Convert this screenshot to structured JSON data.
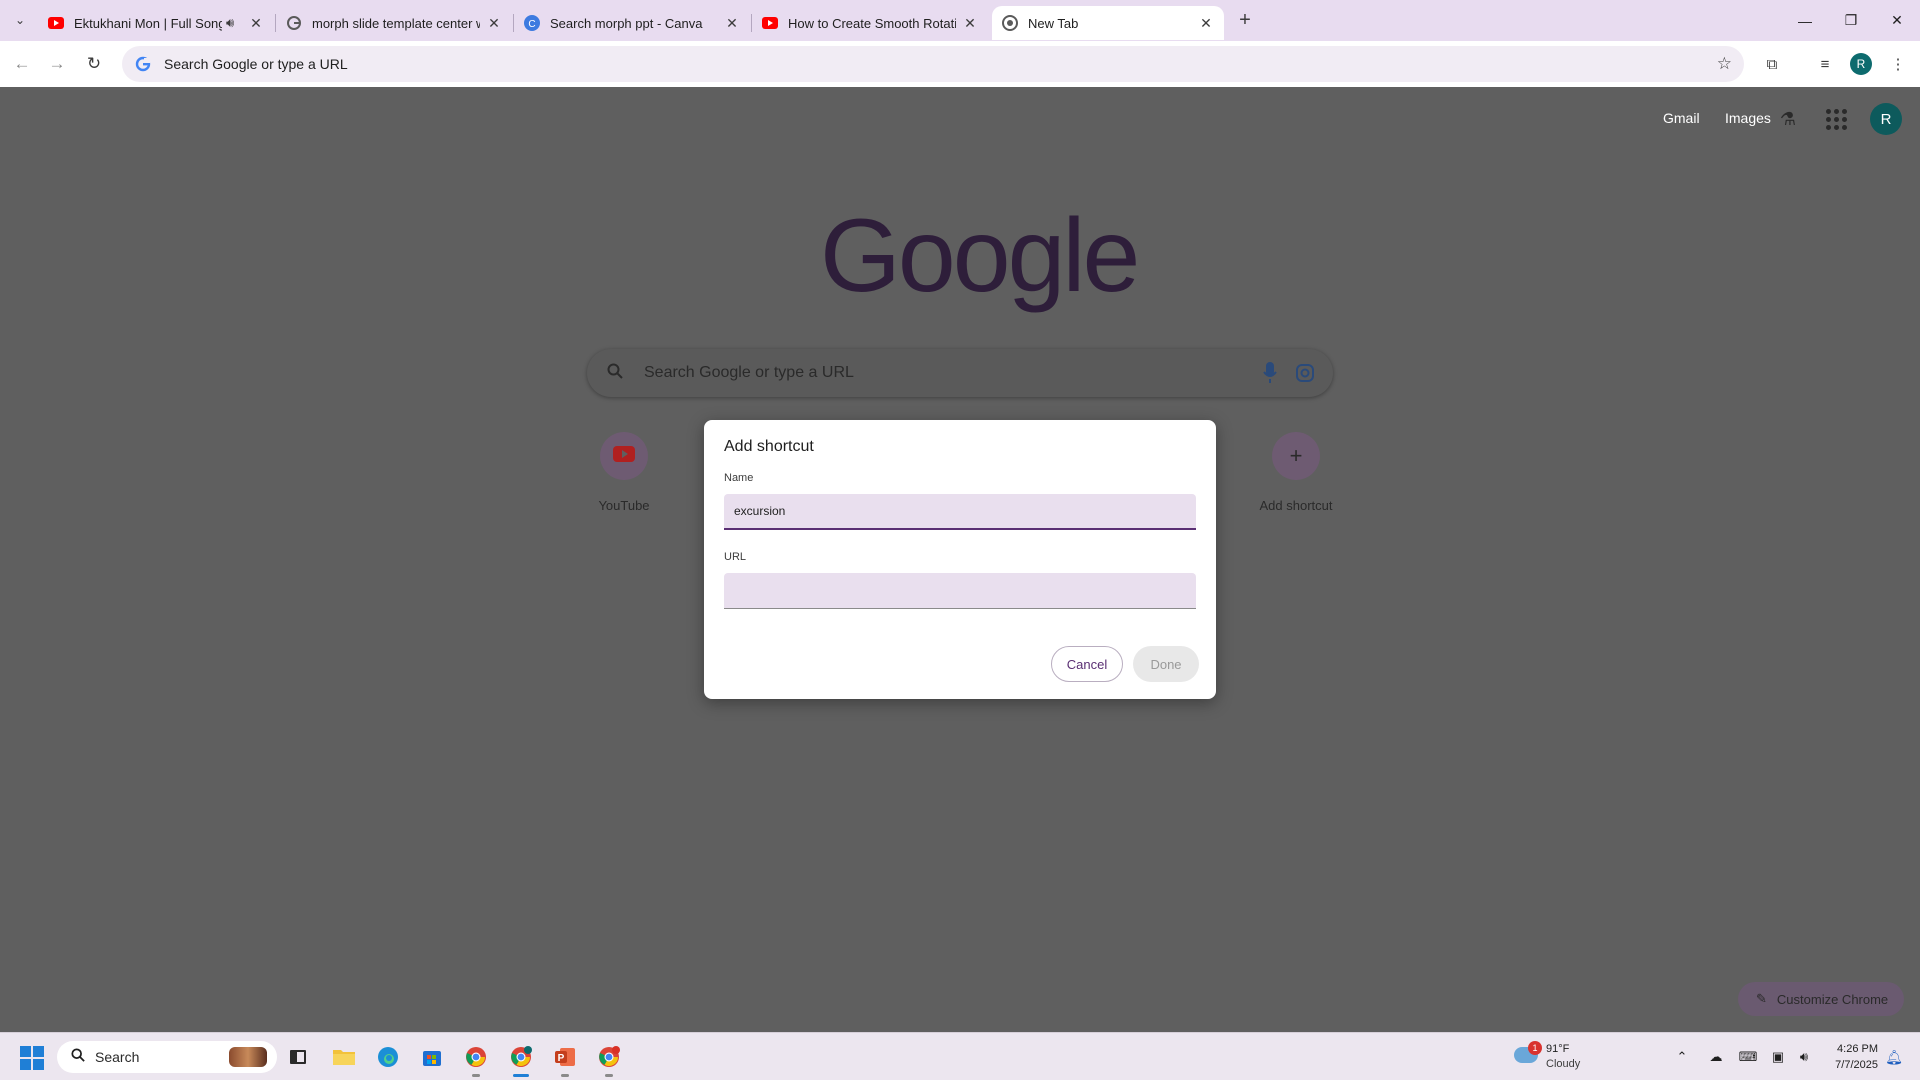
{
  "tabs": [
    {
      "title": "Ektukhani Mon | Full Song |",
      "favicon": "youtube-icon",
      "audio": true,
      "active": false
    },
    {
      "title": "morph slide template center wi",
      "favicon": "google-icon",
      "audio": false,
      "active": false
    },
    {
      "title": "Search morph ppt - Canva",
      "favicon": "canva-icon",
      "audio": false,
      "active": false
    },
    {
      "title": "How to Create Smooth Rotating",
      "favicon": "youtube-icon",
      "audio": false,
      "active": false
    },
    {
      "title": "New Tab",
      "favicon": "chrome-icon",
      "audio": false,
      "active": true
    }
  ],
  "toolbar": {
    "omnibox_text": "Search Google or type a URL",
    "profile_initial": "R"
  },
  "newtab": {
    "links": {
      "gmail": "Gmail",
      "images": "Images"
    },
    "profile_initial": "R",
    "logo": "Google",
    "search_placeholder": "Search Google or type a URL",
    "shortcuts": [
      {
        "label": "YouTube",
        "icon": "youtube-icon"
      },
      {
        "label": "Add shortcut",
        "icon": "plus-icon"
      }
    ],
    "customize_label": "Customize Chrome"
  },
  "dialog": {
    "title": "Add shortcut",
    "name_label": "Name",
    "name_value": "excursion",
    "url_label": "URL",
    "url_value": "",
    "cancel_label": "Cancel",
    "done_label": "Done"
  },
  "taskbar": {
    "search_label": "Search",
    "apps": [
      "task-view-icon",
      "file-explorer-icon",
      "edge-icon",
      "store-icon",
      "chrome-icon",
      "chrome-profile-icon",
      "powerpoint-icon",
      "chrome-canary-icon"
    ],
    "weather": {
      "temp": "91°F",
      "condition": "Cloudy",
      "badge": "1"
    },
    "time": "4:26 PM",
    "date": "7/7/2025"
  },
  "colors": {
    "tabstrip": "#e8dcf0",
    "overlay": "#5f5f5f",
    "accent": "#5a2f73",
    "youtube_red": "#ff0000",
    "avatar": "#0d6b6e"
  }
}
